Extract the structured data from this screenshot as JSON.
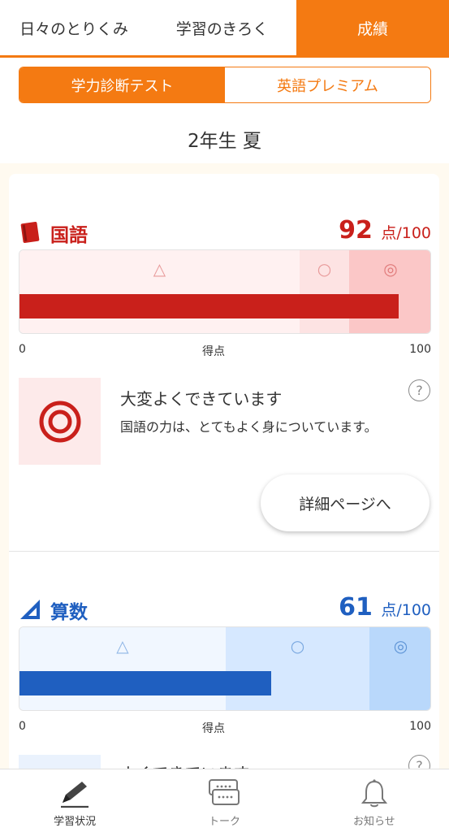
{
  "top_tabs": [
    {
      "label": "日々のとりくみ",
      "active": false
    },
    {
      "label": "学習のきろく",
      "active": false
    },
    {
      "label": "成績",
      "active": true
    }
  ],
  "segment": {
    "options": [
      {
        "label": "学力診断テスト",
        "active": true
      },
      {
        "label": "英語プレミアム",
        "active": false
      }
    ]
  },
  "period": "2年生 夏",
  "subjects": [
    {
      "name": "国語",
      "icon": "book-icon",
      "score": "92",
      "score_unit": "点",
      "score_max": "/100",
      "score_fraction": 0.92,
      "color": "#c9201b",
      "zone_marks": [
        "△",
        "○",
        "◎"
      ],
      "axis": {
        "min": "0",
        "center": "得点",
        "max": "100"
      },
      "evaluation": {
        "title": "大変よくできています",
        "description": "国語の力は、とてもよく身についています。",
        "help": "?"
      },
      "detail_button": "詳細ページへ"
    },
    {
      "name": "算数",
      "icon": "triangle-ruler-icon",
      "score": "61",
      "score_unit": "点",
      "score_max": "/100",
      "score_fraction": 0.61,
      "color": "#1f5fc0",
      "zone_marks": [
        "△",
        "○",
        "◎"
      ],
      "axis": {
        "min": "0",
        "center": "得点",
        "max": "100"
      },
      "evaluation": {
        "title": "よくできています",
        "help": "?"
      }
    }
  ],
  "bottom_nav": [
    {
      "label": "学習状況",
      "icon": "pencil-icon",
      "active": true
    },
    {
      "label": "トーク",
      "icon": "chat-icon",
      "active": false
    },
    {
      "label": "お知らせ",
      "icon": "bell-icon",
      "active": false
    }
  ]
}
